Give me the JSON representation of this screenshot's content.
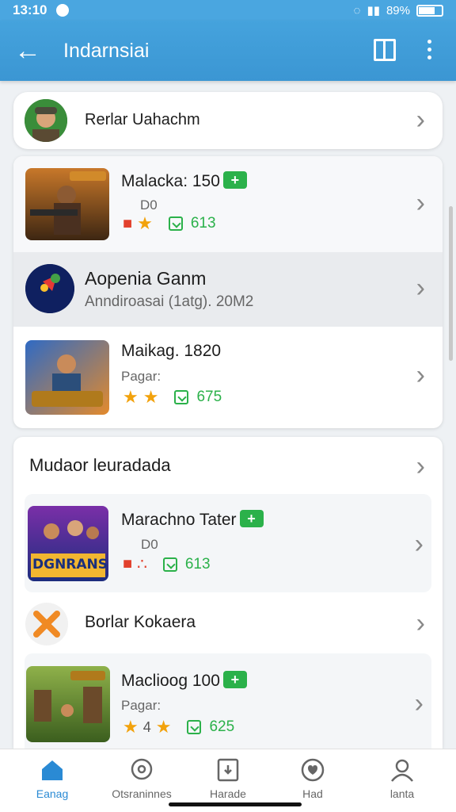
{
  "status": {
    "time": "13:10",
    "battery": "89%"
  },
  "app_bar": {
    "title": "Indarnsiai"
  },
  "profile": {
    "label": "Rerlar Uahachm"
  },
  "list1": [
    {
      "title": "Malacka: 150",
      "sub": "D0",
      "count": "613"
    },
    {
      "title": "Aopenia Ganm",
      "sub": "Anndiroasai (1atg). 20M2"
    },
    {
      "title": "Maikag. 1820",
      "sub": "Pagar:",
      "count": "675"
    }
  ],
  "section2": {
    "header": "Mudaor leuradada"
  },
  "list2": [
    {
      "title": "Marachno Tater",
      "sub": "D0",
      "count": "613",
      "thumb_text": "DGNRANS"
    },
    {
      "title": "Borlar Kokaera"
    },
    {
      "title": "Maclioog 100",
      "sub": "Pagar:",
      "count": "625"
    }
  ],
  "nav": [
    {
      "label": "Eanag",
      "icon": "home-icon"
    },
    {
      "label": "Otsraninnes",
      "icon": "chat-icon"
    },
    {
      "label": "Harade",
      "icon": "bookmark-icon"
    },
    {
      "label": "Had",
      "icon": "heart-icon"
    },
    {
      "label": "lanta",
      "icon": "person-icon"
    }
  ],
  "colors": {
    "primary": "#3b96d3",
    "accent_green": "#2bb14a",
    "star": "#f2a20c",
    "active_nav": "#2a8ad4"
  }
}
